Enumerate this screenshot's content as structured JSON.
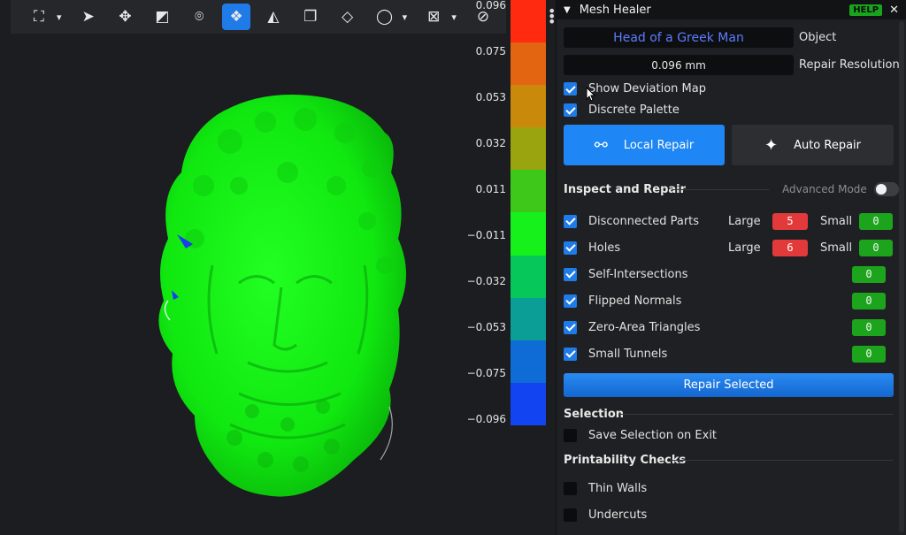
{
  "toolbar": {
    "tools": [
      {
        "name": "selection-frame-icon",
        "glyph": "⛶"
      },
      {
        "name": "pointer-icon",
        "glyph": "➤"
      },
      {
        "name": "move-icon",
        "glyph": "✥"
      },
      {
        "name": "edit-tool-icon",
        "glyph": "◩"
      },
      {
        "name": "pivot-icon",
        "glyph": "⌾"
      },
      {
        "name": "mesh-heal-icon",
        "glyph": "❖"
      },
      {
        "name": "shapes-icon",
        "glyph": "◭"
      },
      {
        "name": "duplicate-icon",
        "glyph": "❐"
      },
      {
        "name": "slice-icon",
        "glyph": "◇"
      },
      {
        "name": "lasso-icon",
        "glyph": "◯"
      },
      {
        "name": "deselect-icon",
        "glyph": "⊠"
      },
      {
        "name": "disable-icon",
        "glyph": "⊘"
      }
    ]
  },
  "color_scale": {
    "labels": [
      "0.096",
      "0.075",
      "0.053",
      "0.032",
      "0.011",
      "−0.011",
      "−0.032",
      "−0.053",
      "−0.075",
      "−0.096"
    ],
    "colors": [
      "#ff2a10",
      "#e36512",
      "#c98a0b",
      "#9aa40e",
      "#3ec81a",
      "#16f11c",
      "#06c85a",
      "#0a9e96",
      "#0f6cd6",
      "#1344f2"
    ]
  },
  "panel": {
    "title": "Mesh Healer",
    "help": "HELP",
    "close": "✕",
    "object_name": "Head of a Greek Man",
    "object_label": "Object",
    "resolution_value": "0.096 mm",
    "resolution_label": "Repair Resolution",
    "show_deviation_map": "Show Deviation Map",
    "discrete_palette": "Discrete Palette",
    "local_repair": "Local Repair",
    "auto_repair": "Auto Repair",
    "inspect_and_repair": "Inspect and Repair",
    "advanced_mode": "Advanced Mode",
    "large_label": "Large",
    "small_label": "Small",
    "checks": [
      {
        "label": "Disconnected Parts",
        "large": "5",
        "small": "0",
        "split": true
      },
      {
        "label": "Holes",
        "large": "6",
        "small": "0",
        "split": true
      },
      {
        "label": "Self-Intersections",
        "value": "0",
        "split": false
      },
      {
        "label": "Flipped Normals",
        "value": "0",
        "split": false
      },
      {
        "label": "Zero-Area Triangles",
        "value": "0",
        "split": false
      },
      {
        "label": "Small Tunnels",
        "value": "0",
        "split": false
      }
    ],
    "repair_selected": "Repair Selected",
    "selection": "Selection",
    "save_selection": "Save Selection on Exit",
    "printability": "Printability Checks",
    "thin_walls": "Thin Walls",
    "undercuts": "Undercuts"
  }
}
